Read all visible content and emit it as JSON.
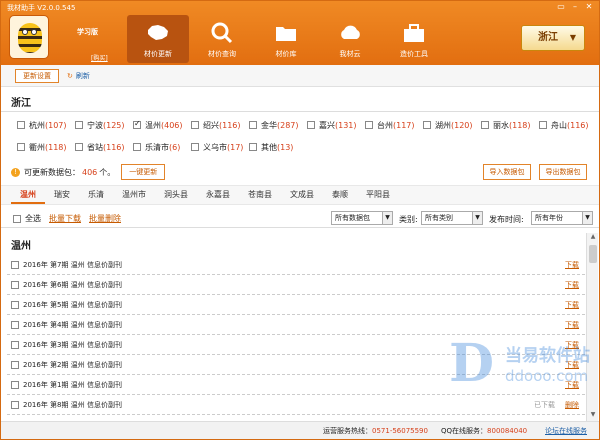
{
  "app": {
    "title": "我材助手 V2.0.0.545",
    "edition": "学习版",
    "buy": "[购买]"
  },
  "nav": [
    {
      "label": "材价更新",
      "icon": "china-map-icon"
    },
    {
      "label": "材价查询",
      "icon": "search-icon"
    },
    {
      "label": "材价库",
      "icon": "folder-icon"
    },
    {
      "label": "我材云",
      "icon": "cloud-icon"
    },
    {
      "label": "造价工具",
      "icon": "toolbox-icon"
    }
  ],
  "province_selector": {
    "value": "浙江",
    "caret": "▼"
  },
  "toolbar": {
    "settings": "更新设置",
    "refresh": "刷新"
  },
  "province": {
    "title": "浙江"
  },
  "cities": [
    {
      "name": "杭州",
      "count": "(107)",
      "checked": false
    },
    {
      "name": "宁波",
      "count": "(125)",
      "checked": false
    },
    {
      "name": "温州",
      "count": "(406)",
      "checked": true
    },
    {
      "name": "绍兴",
      "count": "(116)",
      "checked": false
    },
    {
      "name": "金华",
      "count": "(287)",
      "checked": false
    },
    {
      "name": "嘉兴",
      "count": "(131)",
      "checked": false
    },
    {
      "name": "台州",
      "count": "(117)",
      "checked": false
    },
    {
      "name": "湖州",
      "count": "(120)",
      "checked": false
    },
    {
      "name": "丽水",
      "count": "(118)",
      "checked": false
    },
    {
      "name": "舟山",
      "count": "(116)",
      "checked": false
    },
    {
      "name": "衢州",
      "count": "(118)",
      "checked": false
    },
    {
      "name": "省站",
      "count": "(116)",
      "checked": false
    },
    {
      "name": "乐清市",
      "count": "(6)",
      "checked": false
    },
    {
      "name": "义乌市",
      "count": "(17)",
      "checked": false
    },
    {
      "name": "其他",
      "count": "(13)",
      "checked": false
    }
  ],
  "update": {
    "prefix": "可更新数据包：",
    "count": "406",
    "suffix": "个。",
    "button": "一键更新",
    "import": "导入数据包",
    "export": "导出数据包"
  },
  "tabs": [
    "温州",
    "瑞安",
    "乐清",
    "温州市",
    "洞头县",
    "永嘉县",
    "苍南县",
    "文成县",
    "泰顺",
    "平阳县"
  ],
  "filter": {
    "select_all": "全选",
    "batch_download": "批量下载",
    "batch_delete": "批量删除",
    "package": "所有数据包",
    "type_label": "类别:",
    "type": "所有类别",
    "date_label": "发布时间:",
    "date": "所有年份"
  },
  "list": {
    "title": "温州",
    "items": [
      {
        "title": "2016年 第7期 温州 信息价副刊",
        "action": "下载",
        "status": ""
      },
      {
        "title": "2016年 第6期 温州 信息价副刊",
        "action": "下载",
        "status": ""
      },
      {
        "title": "2016年 第5期 温州 信息价副刊",
        "action": "下载",
        "status": ""
      },
      {
        "title": "2016年 第4期 温州 信息价副刊",
        "action": "下载",
        "status": ""
      },
      {
        "title": "2016年 第3期 温州 信息价副刊",
        "action": "下载",
        "status": ""
      },
      {
        "title": "2016年 第2期 温州 信息价副刊",
        "action": "下载",
        "status": ""
      },
      {
        "title": "2016年 第1期 温州 信息价副刊",
        "action": "下载",
        "status": ""
      },
      {
        "title": "2016年 第8期 温州 信息价副刊",
        "action": "删除",
        "status": "已下载"
      }
    ]
  },
  "status": {
    "hotline_label": "运营服务热线：",
    "hotline": "0571-56075590",
    "qq_label": "QQ在线服务：",
    "qq": "800084040",
    "forum": "论坛在线服务"
  },
  "watermark": {
    "letter": "D",
    "line1": "当易软件站",
    "line2": "ddooo.com"
  },
  "colors": {
    "brand": "#e26e10",
    "accent": "#d6401a",
    "link": "#1d5fa6"
  }
}
